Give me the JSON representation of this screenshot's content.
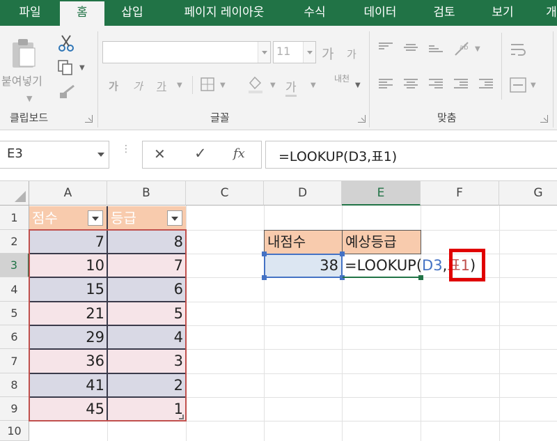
{
  "ribbon_tabs": [
    "파일",
    "홈",
    "삽입",
    "페이지 레이아웃",
    "수식",
    "데이터",
    "검토",
    "보기",
    "개"
  ],
  "active_tab_index": 1,
  "ribbon": {
    "clipboard": {
      "paste_label": "붙여넣기",
      "group_label": "클립보드"
    },
    "font": {
      "font_name": "",
      "font_size": "11",
      "grow_font": "가",
      "shrink_font": "가",
      "bold": "가",
      "italic": "가",
      "underline": "가",
      "font_color": "가",
      "phonetic": "내천",
      "group_label": "글꼴"
    },
    "alignment": {
      "group_label": "맞춤"
    }
  },
  "formula_bar": {
    "name_box": "E3",
    "cancel_symbol": "✕",
    "enter_symbol": "✓",
    "fx_label": "fx",
    "formula": "=LOOKUP(D3,표1)"
  },
  "columns": [
    "A",
    "B",
    "C",
    "D",
    "E",
    "F",
    "G"
  ],
  "selected_column": "E",
  "rows": [
    "1",
    "2",
    "3",
    "4",
    "5",
    "6",
    "7",
    "8",
    "9",
    "10"
  ],
  "selected_row": "3",
  "table": {
    "headers": [
      "점수",
      "등급"
    ],
    "rows": [
      [
        "7",
        "8"
      ],
      [
        "10",
        "7"
      ],
      [
        "15",
        "6"
      ],
      [
        "21",
        "5"
      ],
      [
        "29",
        "4"
      ],
      [
        "36",
        "3"
      ],
      [
        "41",
        "2"
      ],
      [
        "45",
        "1"
      ]
    ]
  },
  "lookup_area": {
    "d2_header": "내점수",
    "e2_header": "예상등급",
    "d3_value": "38",
    "e3_formula_prefix": "=LOOKUP(",
    "e3_formula_ref": "D3",
    "e3_formula_sep": ",",
    "e3_formula_table": "표1",
    "e3_formula_suffix": ")"
  },
  "colors": {
    "excel_green": "#217346",
    "table_header": "#f8cbad",
    "band_dark": "#d9d9e5",
    "band_light": "#f6e4e8",
    "table_border": "#c0504d",
    "ref_blue": "#4472c4",
    "highlight_red": "#e00000"
  }
}
